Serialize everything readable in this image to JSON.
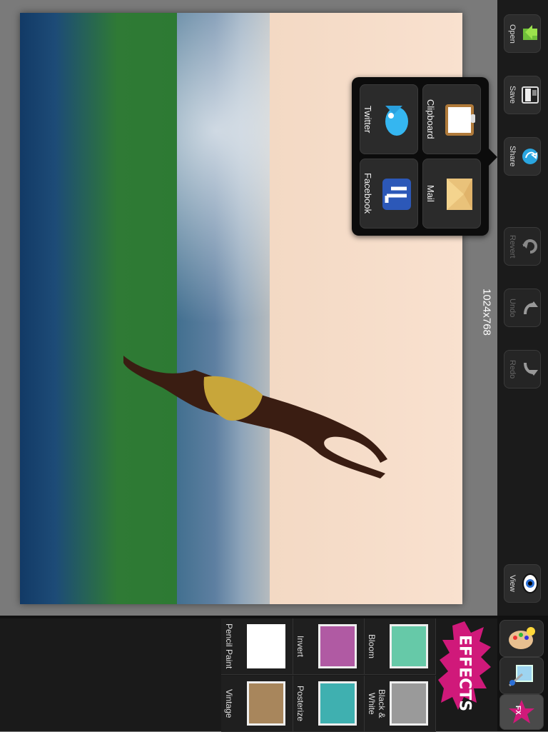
{
  "toolbar": {
    "items": [
      {
        "label": "Open",
        "icon": "open-icon",
        "enabled": true
      },
      {
        "label": "Save",
        "icon": "save-icon",
        "enabled": true
      },
      {
        "label": "Share",
        "icon": "share-icon",
        "enabled": true
      },
      {
        "label": "Revert",
        "icon": "revert-icon",
        "enabled": false
      },
      {
        "label": "Undo",
        "icon": "undo-icon",
        "enabled": false
      },
      {
        "label": "Redo",
        "icon": "redo-icon",
        "enabled": false
      },
      {
        "label": "View",
        "icon": "eye-icon",
        "enabled": true
      }
    ]
  },
  "canvas": {
    "image_size": "1024x768"
  },
  "share_menu": {
    "items": [
      {
        "label": "Clipboard",
        "icon": "clipboard-icon"
      },
      {
        "label": "Mail",
        "icon": "mail-icon"
      },
      {
        "label": "Twitter",
        "icon": "twitter-icon"
      },
      {
        "label": "Facebook",
        "icon": "facebook-icon"
      }
    ]
  },
  "effects": {
    "title": "EFFECTS",
    "items": [
      {
        "label": "Bloom",
        "icon": "tree-thumbnail"
      },
      {
        "label": "Black & White",
        "icon": "tree-thumbnail"
      },
      {
        "label": "Invert",
        "icon": "tree-thumbnail"
      },
      {
        "label": "Posterize",
        "icon": "tree-thumbnail"
      },
      {
        "label": "Pencil Paint",
        "icon": "tree-thumbnail"
      },
      {
        "label": "Vintage",
        "icon": "tree-thumbnail"
      }
    ]
  },
  "mode_tabs": [
    {
      "name": "palette",
      "icon": "palette-icon"
    },
    {
      "name": "crop",
      "icon": "crop-icon"
    },
    {
      "name": "fx",
      "icon": "fx-star-icon",
      "text": "FX",
      "active": true
    }
  ],
  "colors": {
    "toolbar_bg": "#1b1b1b",
    "accent": "#d0197a"
  }
}
